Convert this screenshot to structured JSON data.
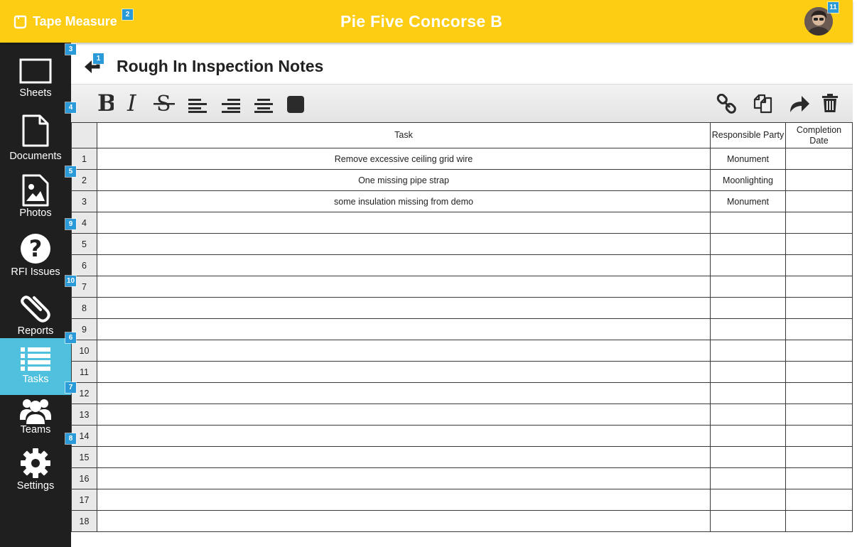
{
  "app": {
    "brand": "Tape Measure",
    "project_title": "Pie Five Concorse B"
  },
  "badges": [
    "1",
    "2",
    "3",
    "4",
    "5",
    "6",
    "7",
    "8",
    "9",
    "10",
    "11"
  ],
  "sidebar": {
    "items": [
      {
        "label": "Sheets",
        "icon": "sheet-icon"
      },
      {
        "label": "Documents",
        "icon": "document-icon"
      },
      {
        "label": "Photos",
        "icon": "photo-icon"
      },
      {
        "label": "RFI Issues",
        "icon": "question-icon"
      },
      {
        "label": "Reports",
        "icon": "paperclip-icon"
      },
      {
        "label": "Tasks",
        "icon": "list-icon",
        "active": true
      },
      {
        "label": "Teams",
        "icon": "people-icon"
      },
      {
        "label": "Settings",
        "icon": "gear-icon"
      }
    ]
  },
  "document": {
    "title": "Rough In Inspection Notes"
  },
  "toolbar": {
    "left": [
      "bold-icon",
      "italic-icon",
      "strikethrough-icon",
      "align-left-icon",
      "align-right-icon",
      "align-center-icon",
      "color-swatch-icon"
    ],
    "right": [
      "link-icon",
      "copy-icon",
      "share-icon",
      "trash-icon"
    ]
  },
  "table": {
    "headers": {
      "task": "Task",
      "party": "Responsible Party",
      "date": "Completion Date"
    },
    "rows": [
      {
        "n": "1",
        "task": "Remove excessive ceiling grid wire",
        "party": "Monument",
        "date": ""
      },
      {
        "n": "2",
        "task": "One missing pipe strap",
        "party": "Moonlighting",
        "date": ""
      },
      {
        "n": "3",
        "task": "some insulation missing from demo",
        "party": "Monument",
        "date": ""
      },
      {
        "n": "4",
        "task": "",
        "party": "",
        "date": ""
      },
      {
        "n": "5",
        "task": "",
        "party": "",
        "date": ""
      },
      {
        "n": "6",
        "task": "",
        "party": "",
        "date": ""
      },
      {
        "n": "7",
        "task": "",
        "party": "",
        "date": ""
      },
      {
        "n": "8",
        "task": "",
        "party": "",
        "date": ""
      },
      {
        "n": "9",
        "task": "",
        "party": "",
        "date": ""
      },
      {
        "n": "10",
        "task": "",
        "party": "",
        "date": ""
      },
      {
        "n": "11",
        "task": "",
        "party": "",
        "date": ""
      },
      {
        "n": "12",
        "task": "",
        "party": "",
        "date": ""
      },
      {
        "n": "13",
        "task": "",
        "party": "",
        "date": ""
      },
      {
        "n": "14",
        "task": "",
        "party": "",
        "date": ""
      },
      {
        "n": "15",
        "task": "",
        "party": "",
        "date": ""
      },
      {
        "n": "16",
        "task": "",
        "party": "",
        "date": ""
      },
      {
        "n": "17",
        "task": "",
        "party": "",
        "date": ""
      },
      {
        "n": "18",
        "task": "",
        "party": "",
        "date": ""
      }
    ]
  },
  "colors": {
    "brand_yellow": "#fccd12",
    "sidebar_bg": "#1f1f1f",
    "active_tab": "#4fc1de",
    "badge": "#2a9ad8"
  }
}
